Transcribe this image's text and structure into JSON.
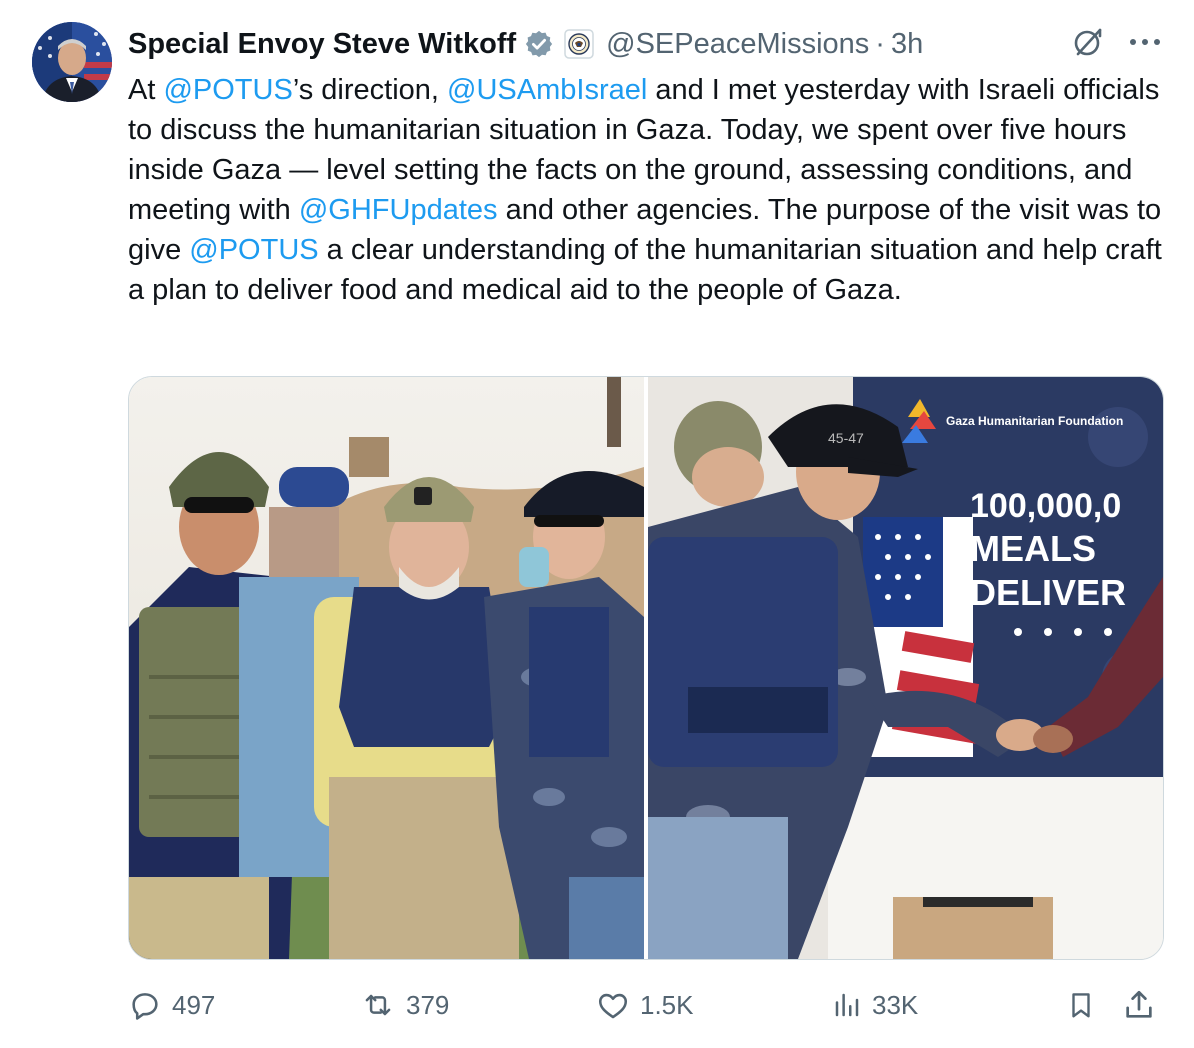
{
  "author": {
    "display_name": "Special Envoy Steve Witkoff",
    "handle": "@SEPeaceMissions",
    "separator": "·",
    "time": "3h",
    "verified_icon": "verified-badge-icon",
    "affiliation_icon": "state-department-seal-icon"
  },
  "tweet": {
    "segments": [
      {
        "text": "At ",
        "type": "text"
      },
      {
        "text": "@POTUS",
        "type": "mention"
      },
      {
        "text": "’s direction, ",
        "type": "text"
      },
      {
        "text": "@USAmbIsrael",
        "type": "mention"
      },
      {
        "text": " and I met yesterday with Israeli officials to discuss the humanitarian situation in Gaza. Today, we spent over five hours inside Gaza — level setting the facts on the ground, assessing conditions, and meeting with ",
        "type": "text"
      },
      {
        "text": "@GHFUpdates",
        "type": "mention"
      },
      {
        "text": " and other agencies. The purpose of the visit was to give ",
        "type": "text"
      },
      {
        "text": "@POTUS",
        "type": "mention"
      },
      {
        "text": " a clear understanding of the humanitarian situation and help craft a plan to deliver food and medical aid to the people of Gaza.",
        "type": "text"
      }
    ]
  },
  "media": {
    "left_photo_label": "Officials in helmets and protective vests",
    "right_photo": {
      "banner_org": "Gaza Humanitarian Foundation",
      "banner_line1": "100,000,0",
      "banner_line2": "MEALS",
      "banner_line3": "DELIVER",
      "cap_text": "45-47"
    }
  },
  "metrics": {
    "replies": "497",
    "reposts": "379",
    "likes": "1.5K",
    "views": "33K"
  },
  "colors": {
    "accent": "#1d9bf0",
    "muted": "#536471",
    "text": "#0f1419",
    "border": "#cfd9de"
  }
}
